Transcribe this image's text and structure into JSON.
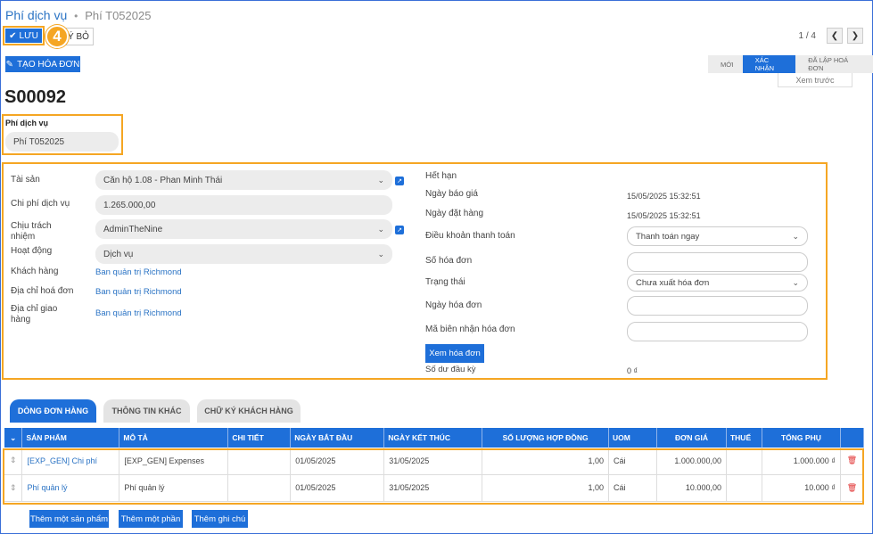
{
  "breadcrumb": {
    "parent": "Phí dịch vụ",
    "separator": "•",
    "current": "Phí T052025"
  },
  "toolbar": {
    "save_label": "LƯU",
    "discard_label": "Ý BỎ",
    "step_badge": "4"
  },
  "pager": {
    "text": "1 / 4"
  },
  "actions": {
    "create_invoice": "TẠO HÓA ĐƠN",
    "preview": "Xem trước"
  },
  "status_bar": {
    "steps": [
      "MỚI",
      "XÁC NHẬN",
      "ĐÃ LẬP HOÁ ĐƠN"
    ],
    "active": "XÁC NHẬN"
  },
  "record": {
    "name": "S00092"
  },
  "service_fee": {
    "label": "Phí dịch vụ",
    "value": "Phí T052025"
  },
  "left_fields": {
    "asset_label": "Tài sản",
    "asset_value": "Căn hộ 1.08 - Phan Minh Thái",
    "cost_label": "Chi phí dịch vụ",
    "cost_value": "1.265.000,00",
    "owner_label_1": "Chịu trách",
    "owner_label_2": "nhiệm",
    "owner_value": "AdminTheNine",
    "activity_label": "Hoạt động",
    "activity_value": "Dịch vụ",
    "customer_label": "Khách hàng",
    "customer_value": "Ban quản trị Richmond",
    "invoice_addr_label": "Địa chỉ hoá đơn",
    "invoice_addr_value": "Ban quản trị Richmond",
    "delivery_addr_label_1": "Địa chỉ giao",
    "delivery_addr_label_2": "hàng",
    "delivery_addr_value": "Ban quản trị Richmond"
  },
  "right_fields": {
    "expire_label": "Hết hạn",
    "quote_date_label": "Ngày báo giá",
    "quote_date_value": "15/05/2025 15:32:51",
    "order_date_label": "Ngày đặt hàng",
    "order_date_value": "15/05/2025 15:32:51",
    "payment_terms_label": "Điều khoản thanh toán",
    "payment_terms_value": "Thanh toán ngay",
    "invoice_no_label": "Số hóa đơn",
    "status_label": "Trạng thái",
    "status_value": "Chưa xuất hóa đơn",
    "invoice_date_label": "Ngày hóa đơn",
    "receipt_code_label": "Mã biên nhận hóa đơn",
    "view_invoice_button": "Xem hóa đơn",
    "opening_balance_label": "Số dư đầu kỳ",
    "opening_balance_value": "0 ₫"
  },
  "tabs": [
    "DÒNG ĐƠN HÀNG",
    "THÔNG TIN KHÁC",
    "CHỮ KÝ KHÁCH HÀNG"
  ],
  "table": {
    "headers": [
      "SẢN PHẨM",
      "MÔ TẢ",
      "CHI TIẾT",
      "NGÀY BẮT ĐẦU",
      "NGÀY KẾT THÚC",
      "SỐ LƯỢNG HỢP ĐỒNG",
      "UOM",
      "ĐƠN GIÁ",
      "THUẾ",
      "TỔNG PHỤ"
    ],
    "rows": [
      {
        "product": "[EXP_GEN] Chi phí",
        "description": "[EXP_GEN] Expenses",
        "detail": "",
        "start": "01/05/2025",
        "end": "31/05/2025",
        "qty": "1,00",
        "uom": "Cái",
        "price": "1.000.000,00",
        "tax": "",
        "subtotal": "1.000.000 ₫"
      },
      {
        "product": "Phí quản lý",
        "description": "Phí quản lý",
        "detail": "",
        "start": "01/05/2025",
        "end": "31/05/2025",
        "qty": "1,00",
        "uom": "Cái",
        "price": "10.000,00",
        "tax": "",
        "subtotal": "10.000 ₫"
      }
    ]
  },
  "footer_buttons": {
    "add_product": "Thêm một sản phẩm",
    "add_section": "Thêm một phần",
    "add_note": "Thêm ghi chú"
  },
  "colors": {
    "primary": "#1e6fd9",
    "highlight": "#f5a623"
  }
}
